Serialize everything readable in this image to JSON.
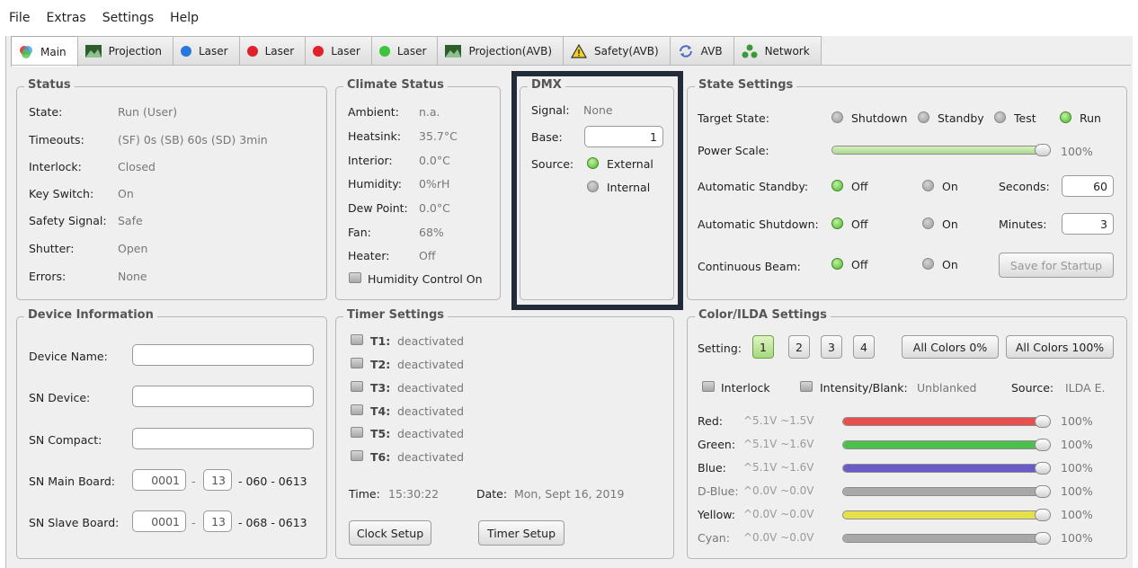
{
  "menu": [
    "File",
    "Extras",
    "Settings",
    "Help"
  ],
  "tabs": [
    {
      "label": "Main",
      "icon": "color-wheel-icon",
      "color": "#e8443c"
    },
    {
      "label": "Projection",
      "icon": "projection-image-icon",
      "color": "#2e5d2e"
    },
    {
      "label": "Laser",
      "icon": "blue-laser-dot-icon",
      "color": "#2878e0"
    },
    {
      "label": "Laser",
      "icon": "red-laser-dot-icon",
      "color": "#e0202a"
    },
    {
      "label": "Laser",
      "icon": "red-laser-dot-icon",
      "color": "#e0202a"
    },
    {
      "label": "Laser",
      "icon": "green-laser-dot-icon",
      "color": "#3cc43c"
    },
    {
      "label": "Projection(AVB)",
      "icon": "projection-image-icon",
      "color": "#2e5d2e"
    },
    {
      "label": "Safety(AVB)",
      "icon": "warning-triangle-icon",
      "color": "#f0d020"
    },
    {
      "label": "AVB",
      "icon": "sync-arrows-icon",
      "color": "#4a6ac8"
    },
    {
      "label": "Network",
      "icon": "network-icon",
      "color": "#3a9a3a"
    }
  ],
  "status": {
    "title": "Status",
    "rows": [
      {
        "label": "State:",
        "value": "Run (User)"
      },
      {
        "label": "Timeouts:",
        "value": "(SF) 0s  (SB) 60s  (SD) 3min"
      },
      {
        "label": "Interlock:",
        "value": "Closed"
      },
      {
        "label": "Key Switch:",
        "value": "On"
      },
      {
        "label": "Safety Signal:",
        "value": "Safe"
      },
      {
        "label": "Shutter:",
        "value": "Open"
      },
      {
        "label": "Errors:",
        "value": "None"
      }
    ]
  },
  "climate": {
    "title": "Climate Status",
    "rows": [
      {
        "label": "Ambient:",
        "value": "n.a."
      },
      {
        "label": "Heatsink:",
        "value": "35.7°C"
      },
      {
        "label": "Interior:",
        "value": "0.0°C"
      },
      {
        "label": "Humidity:",
        "value": "0%rH"
      },
      {
        "label": "Dew Point:",
        "value": "0.0°C"
      },
      {
        "label": "Fan:",
        "value": "68%"
      },
      {
        "label": "Heater:",
        "value": "Off"
      }
    ],
    "humidity_control": "Humidity Control On"
  },
  "dmx": {
    "title": "DMX",
    "signal_label": "Signal:",
    "signal_value": "None",
    "base_label": "Base:",
    "base_value": "1",
    "source_label": "Source:",
    "source_external": "External",
    "source_internal": "Internal"
  },
  "state_settings": {
    "title": "State Settings",
    "target_label": "Target State:",
    "target_options": [
      "Shutdown",
      "Standby",
      "Test",
      "Run"
    ],
    "target_selected": "Run",
    "power_label": "Power Scale:",
    "power_value": "100%",
    "power_level": 1.0,
    "auto_standby_label": "Automatic Standby:",
    "auto_shutdown_label": "Automatic Shutdown:",
    "continuous_label": "Continuous Beam:",
    "off": "Off",
    "on": "On",
    "seconds_label": "Seconds:",
    "seconds_value": "60",
    "minutes_label": "Minutes:",
    "minutes_value": "3",
    "save_button": "Save for Startup"
  },
  "device": {
    "title": "Device Information",
    "name_label": "Device Name:",
    "sn_device_label": "SN Device:",
    "sn_compact_label": "SN Compact:",
    "main_board_label": "SN Main Board:",
    "main_board": [
      "0001",
      "13",
      "- 060 - 0613"
    ],
    "slave_board_label": "SN Slave Board:",
    "slave_board": [
      "0001",
      "13",
      "- 068 - 0613"
    ],
    "dash": "-"
  },
  "timer": {
    "title": "Timer Settings",
    "timers": [
      {
        "label": "T1:",
        "value": "deactivated"
      },
      {
        "label": "T2:",
        "value": "deactivated"
      },
      {
        "label": "T3:",
        "value": "deactivated"
      },
      {
        "label": "T4:",
        "value": "deactivated"
      },
      {
        "label": "T5:",
        "value": "deactivated"
      },
      {
        "label": "T6:",
        "value": "deactivated"
      }
    ],
    "time_label": "Time:",
    "time_value": "15:30:22",
    "date_label": "Date:",
    "date_value": "Mon, Sept 16, 2019",
    "clock_button": "Clock Setup",
    "timer_button": "Timer Setup"
  },
  "color": {
    "title": "Color/ILDA Settings",
    "setting_label": "Setting:",
    "settings": [
      "1",
      "2",
      "3",
      "4"
    ],
    "selected_setting": "1",
    "all_0": "All Colors 0%",
    "all_100": "All Colors 100%",
    "interlock": "Interlock",
    "intensity_label": "Intensity/Blank:",
    "intensity_value": "Unblanked",
    "source_label": "Source:",
    "source_value": "ILDA E.",
    "channels": [
      {
        "name": "Red:",
        "volts": "^5.1V ~1.5V",
        "value": "100%",
        "color": "#e85050",
        "level": 1.0,
        "active": true
      },
      {
        "name": "Green:",
        "volts": "^5.1V ~1.6V",
        "value": "100%",
        "color": "#4cbf4c",
        "level": 1.0,
        "active": true
      },
      {
        "name": "Blue:",
        "volts": "^5.1V ~1.6V",
        "value": "100%",
        "color": "#6a5cc8",
        "level": 1.0,
        "active": true
      },
      {
        "name": "D-Blue:",
        "volts": "^0.0V ~0.0V",
        "value": "100%",
        "color": "#a8a8a8",
        "level": 1.0,
        "active": false
      },
      {
        "name": "Yellow:",
        "volts": "^0.0V ~0.0V",
        "value": "100%",
        "color": "#e6e04a",
        "level": 1.0,
        "active": true
      },
      {
        "name": "Cyan:",
        "volts": "^0.0V ~0.0V",
        "value": "100%",
        "color": "#a8a8a8",
        "level": 1.0,
        "active": false
      }
    ]
  }
}
